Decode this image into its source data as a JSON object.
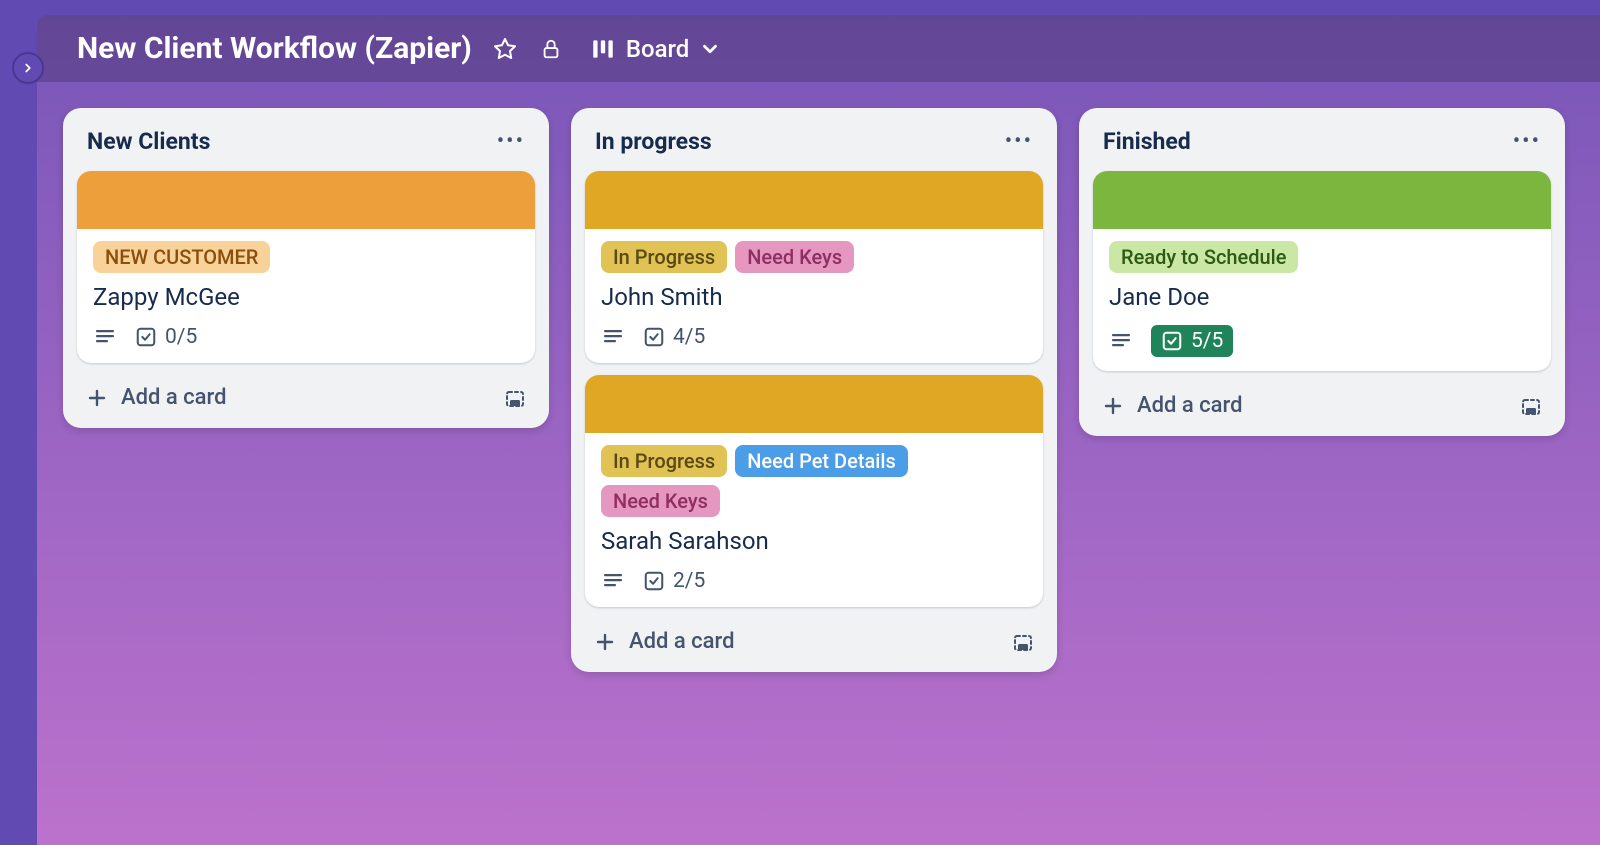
{
  "board": {
    "title": "New Client Workflow (Zapier)",
    "viewLabel": "Board"
  },
  "colors": {
    "orange": "#ec9f3a",
    "orangeLabelBg": "#f8d299",
    "orangeLabelText": "#8a4e0d",
    "yellow": "#dfa724",
    "yellowLabelBg": "#e0c354",
    "yellowLabelText": "#5a4a12",
    "pinkLabelBg": "#e597c0",
    "pinkLabelText": "#8f2e60",
    "blueLabelBg": "#4a9de6",
    "blueLabelText": "#ffffff",
    "green": "#7db63f",
    "greenLabelBg": "#cbe7a5",
    "greenLabelText": "#2d5a15"
  },
  "lists": [
    {
      "name": "New Clients",
      "addLabel": "Add a card",
      "cards": [
        {
          "coverColor": "#ec9f3a",
          "labels": [
            {
              "text": "NEW CUSTOMER",
              "bg": "#f8d299",
              "fg": "#8a4e0d"
            }
          ],
          "title": "Zappy McGee",
          "checklist": "0/5",
          "checklistComplete": false
        }
      ]
    },
    {
      "name": "In progress",
      "addLabel": "Add a card",
      "cards": [
        {
          "coverColor": "#dfa724",
          "labels": [
            {
              "text": "In Progress",
              "bg": "#e0c354",
              "fg": "#5a4a12"
            },
            {
              "text": "Need Keys",
              "bg": "#e597c0",
              "fg": "#8f2e60"
            }
          ],
          "title": "John Smith",
          "checklist": "4/5",
          "checklistComplete": false
        },
        {
          "coverColor": "#dfa724",
          "labels": [
            {
              "text": "In Progress",
              "bg": "#e0c354",
              "fg": "#5a4a12"
            },
            {
              "text": "Need Pet Details",
              "bg": "#4a9de6",
              "fg": "#ffffff"
            },
            {
              "text": "Need Keys",
              "bg": "#e597c0",
              "fg": "#8f2e60"
            }
          ],
          "title": "Sarah Sarahson",
          "checklist": "2/5",
          "checklistComplete": false
        }
      ]
    },
    {
      "name": "Finished",
      "addLabel": "Add a card",
      "cards": [
        {
          "coverColor": "#7db63f",
          "labels": [
            {
              "text": "Ready to Schedule",
              "bg": "#cbe7a5",
              "fg": "#2d5a15"
            }
          ],
          "title": "Jane Doe",
          "checklist": "5/5",
          "checklistComplete": true
        }
      ]
    }
  ]
}
